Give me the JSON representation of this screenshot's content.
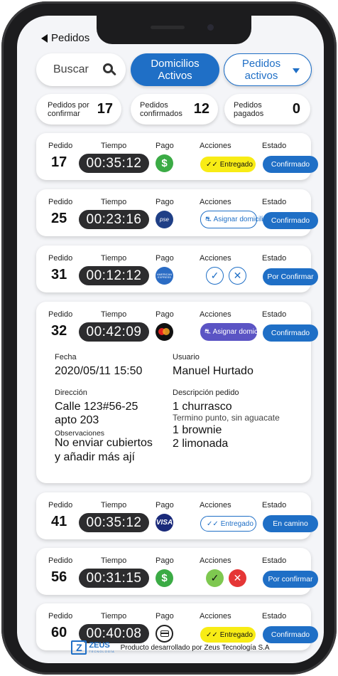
{
  "nav": {
    "back_label": "Pedidos"
  },
  "filters": {
    "search_label": "Buscar",
    "domicilios_label": "Domicilios Activos",
    "pedidos_label": "Pedidos activos"
  },
  "stats": [
    {
      "label": "Pedidos por confirmar",
      "value": "17"
    },
    {
      "label": "Pedidos confirmados",
      "value": "12"
    },
    {
      "label": "Pedidos pagados",
      "value": "0"
    }
  ],
  "headers": {
    "pedido": "Pedido",
    "tiempo": "Tiempo",
    "pago": "Pago",
    "acciones": "Acciones",
    "estado": "Estado"
  },
  "orders": [
    {
      "number": "17",
      "time": "00:35:12",
      "payment": "cash-icon",
      "payment_symbol": "$",
      "action": "Entregado",
      "status": "Confirmado"
    },
    {
      "number": "25",
      "time": "00:23:16",
      "payment": "pse-icon",
      "payment_symbol": "pse",
      "action": "Asignar domicilia...",
      "status": "Confirmado"
    },
    {
      "number": "31",
      "time": "00:12:12",
      "payment": "amex-icon",
      "payment_symbol": "AMERICAN EXPRESS",
      "action": "",
      "status": "Por Confirmar"
    },
    {
      "number": "32",
      "time": "00:42:09",
      "payment": "mastercard-icon",
      "payment_symbol": "",
      "action": "Asignar domicilia...",
      "status": "Confirmado"
    },
    {
      "number": "41",
      "time": "00:35:12",
      "payment": "visa-icon",
      "payment_symbol": "VISA",
      "action": "Entregado",
      "status": "En camino"
    },
    {
      "number": "56",
      "time": "00:31:15",
      "payment": "cash-icon",
      "payment_symbol": "$",
      "action": "",
      "status": "Por confirmar"
    },
    {
      "number": "60",
      "time": "00:40:08",
      "payment": "card-icon",
      "payment_symbol": "",
      "action": "Entregado",
      "status": "Confirmado"
    }
  ],
  "detail": {
    "fecha_label": "Fecha",
    "fecha": "2020/05/11 15:50",
    "usuario_label": "Usuario",
    "usuario": "Manuel Hurtado",
    "direccion_label": "Dirección",
    "direccion_1": "Calle 123#56-25",
    "direccion_2": "apto 203",
    "obs_label": "Observaciones",
    "obs_1": "No enviar cubiertos",
    "obs_2": "y añadir más ají",
    "desc_label": "Descripción pedido",
    "item_1": "1 churrasco",
    "item_1_note": "Termino punto, sin aguacate",
    "item_2": "1 brownie",
    "item_3": "2 limonada"
  },
  "footer": {
    "brand": "ZEUS",
    "brand_sub": "TECNOLOGÍA",
    "text": "Producto desarrollado por Zeus Tecnología S.A"
  },
  "colors": {
    "primary": "#1f6fc6",
    "yellow": "#f8ec15",
    "purple": "#5b54c4",
    "dark": "#2c2c2e",
    "green": "#3bab45"
  }
}
